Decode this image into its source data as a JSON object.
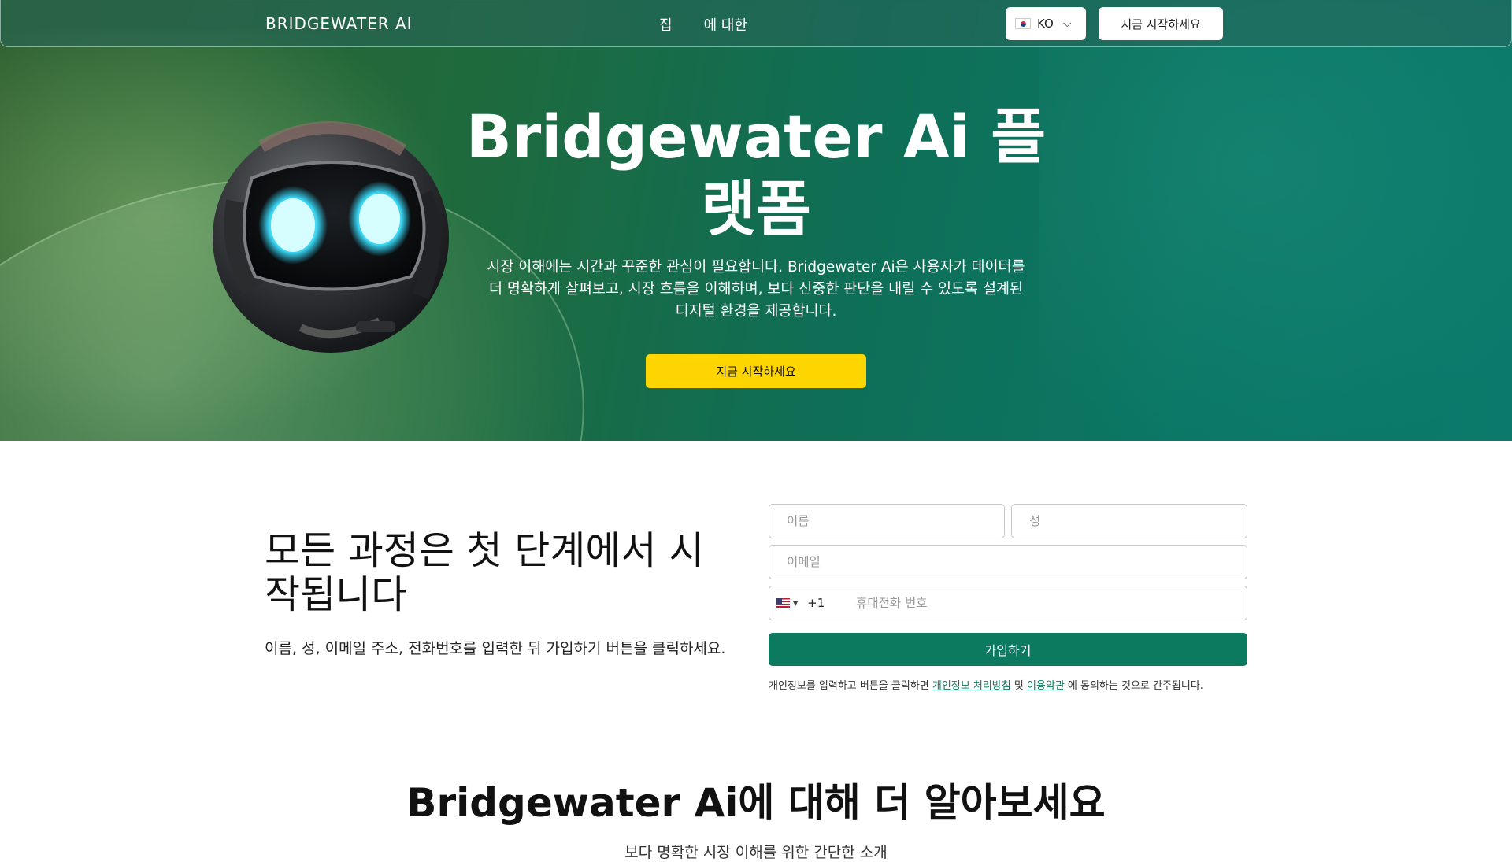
{
  "nav": {
    "brand": "BRIDGEWATER AI",
    "links": [
      "집",
      "에 대한"
    ],
    "language": "KO",
    "cta": "지금 시작하세요"
  },
  "hero": {
    "title": "Bridgewater Ai 플랫폼",
    "description": "시장 이해에는 시간과 꾸준한 관심이 필요합니다. Bridgewater Ai은 사용자가 데이터를 더 명확하게 살펴보고, 시장 흐름을 이해하며, 보다 신중한 판단을 내릴 수 있도록 설계된 디지털 환경을 제공합니다.",
    "cta": "지금 시작하세요"
  },
  "signup": {
    "title": "모든 과정은 첫 단계에서 시작됩니다",
    "description": "이름, 성, 이메일 주소, 전화번호를 입력한 뒤 가입하기 버튼을 클릭하세요.",
    "first_name_placeholder": "이름",
    "last_name_placeholder": "성",
    "email_placeholder": "이메일",
    "phone_dial_code": "+1",
    "phone_placeholder": "휴대전화 번호",
    "submit": "가입하기",
    "consent_prefix": "개인정보를 입력하고 버튼을 클릭하면 ",
    "privacy_link": "개인정보 처리방침",
    "consent_and": " 및 ",
    "terms_link": "이용약관",
    "consent_suffix": " 에 동의하는 것으로 간주됩니다."
  },
  "learn": {
    "title": "Bridgewater Ai에 대해 더 알아보세요",
    "subtitle": "보다 명확한 시장 이해를 위한 간단한 소개"
  },
  "colors": {
    "hero_accent": "#0b7a6c",
    "cta_yellow": "#ffd500",
    "submit_green": "#0b7a5e"
  },
  "icons": {
    "language_flag": "korea-flag-icon",
    "language_chevron": "chevron-down-icon",
    "phone_flag": "us-flag-icon",
    "hero_illustration": "robot-mascot"
  }
}
